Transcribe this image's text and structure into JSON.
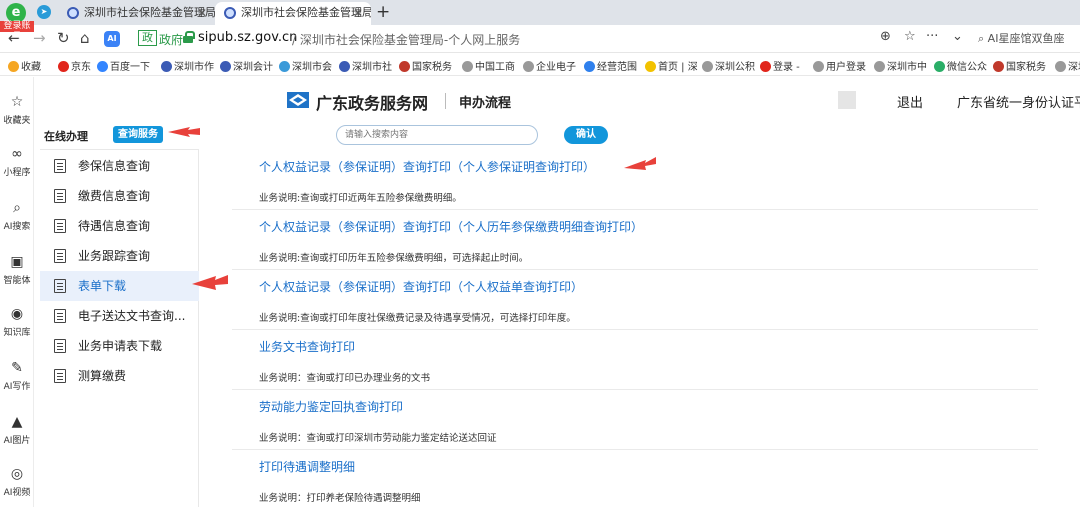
{
  "browser": {
    "login_badge": "登录账号",
    "tabs": [
      {
        "title": "深圳市社会保险基金管理局-"
      },
      {
        "title": "深圳市社会保险基金管理局-"
      }
    ],
    "address": {
      "gov_label": "政府",
      "host": "sipub.sz.gov.cn",
      "path": "/ 深圳市社会保险基金管理局-个人网上服务",
      "search_text": "AI星座馆双鱼座"
    },
    "bookmarks": [
      {
        "label": "收藏",
        "color": "#f5a623"
      },
      {
        "label": "京东",
        "color": "#e1251b"
      },
      {
        "label": "百度一下",
        "color": "#3385ff"
      },
      {
        "label": "深圳市作",
        "color": "#3b5bb5"
      },
      {
        "label": "深圳会计",
        "color": "#3b5bb5"
      },
      {
        "label": "深圳市会",
        "color": "#3b9ad9"
      },
      {
        "label": "深圳市社",
        "color": "#3b5bb5"
      },
      {
        "label": "国家税务",
        "color": "#c0392b"
      },
      {
        "label": "中国工商",
        "color": "#999999"
      },
      {
        "label": "企业电子",
        "color": "#999999"
      },
      {
        "label": "经营范围",
        "color": "#2f80ed"
      },
      {
        "label": "首页 | 深",
        "color": "#f2c200"
      },
      {
        "label": "深圳公积",
        "color": "#999999"
      },
      {
        "label": "登录 -",
        "color": "#e1251b"
      },
      {
        "label": "用户登录",
        "color": "#999999"
      },
      {
        "label": "深圳市中",
        "color": "#999999"
      },
      {
        "label": "微信公众",
        "color": "#2aae67"
      },
      {
        "label": "国家税务",
        "color": "#c0392b"
      },
      {
        "label": "深圳",
        "color": "#999999"
      }
    ],
    "sidebar": [
      {
        "label": "收藏夹",
        "icon": "☆"
      },
      {
        "label": "小程序",
        "icon": "∞"
      },
      {
        "label": "AI搜索",
        "icon": "⌕"
      },
      {
        "label": "智能体",
        "icon": "▣"
      },
      {
        "label": "知识库",
        "icon": "◉"
      },
      {
        "label": "AI写作",
        "icon": "✎"
      },
      {
        "label": "AI图片",
        "icon": "▲"
      },
      {
        "label": "AI视频",
        "icon": "◎"
      }
    ]
  },
  "header": {
    "site_title": "广东政务服务网",
    "subtitle": "申办流程",
    "logout": "退出",
    "auth_platform": "广东省统一身份认证平台"
  },
  "toolbar": {
    "online_label": "在线办理",
    "query_service": "查询服务",
    "search_placeholder": "请输入搜索内容",
    "confirm": "确认"
  },
  "menu": [
    {
      "label": "参保信息查询",
      "active": false
    },
    {
      "label": "缴费信息查询",
      "active": false
    },
    {
      "label": "待遇信息查询",
      "active": false
    },
    {
      "label": "业务跟踪查询",
      "active": false
    },
    {
      "label": "表单下载",
      "active": true
    },
    {
      "label": "电子送达文书查询...",
      "active": false
    },
    {
      "label": "业务申请表下载",
      "active": false
    },
    {
      "label": "测算缴费",
      "active": false
    }
  ],
  "entries": [
    {
      "title": "个人权益记录（参保证明）查询打印（个人参保证明查询打印）",
      "desc": "业务说明:查询或打印近两年五险参保缴费明细。"
    },
    {
      "title": "个人权益记录（参保证明）查询打印（个人历年参保缴费明细查询打印）",
      "desc": "业务说明:查询或打印历年五险参保缴费明细，可选择起止时间。"
    },
    {
      "title": "个人权益记录（参保证明）查询打印（个人权益单查询打印）",
      "desc": "业务说明:查询或打印年度社保缴费记录及待遇享受情况，可选择打印年度。"
    },
    {
      "title": "业务文书查询打印",
      "desc": "业务说明：查询或打印已办理业务的文书"
    },
    {
      "title": "劳动能力鉴定回执查询打印",
      "desc": "业务说明：查询或打印深圳市劳动能力鉴定结论送达回证"
    },
    {
      "title": "打印待遇调整明细",
      "desc": "业务说明：打印养老保险待遇调整明细"
    }
  ],
  "colors": {
    "link_blue": "#1a6fc9",
    "button_blue": "#1296db",
    "arrow_red": "#e8413b"
  }
}
